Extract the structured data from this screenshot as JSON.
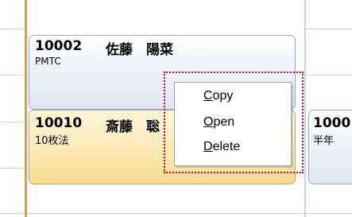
{
  "cards": [
    {
      "id": "10002",
      "name": "佐藤　陽菜",
      "sub": "PMTC",
      "color": "blue"
    },
    {
      "id": "10010",
      "name": "斎藤　聡",
      "sub": "10枚法",
      "color": "yellow"
    },
    {
      "id": "1000",
      "name": "",
      "sub": "半年",
      "color": "blue"
    }
  ],
  "context_menu": {
    "items": [
      {
        "label": "Copy",
        "accel": "C"
      },
      {
        "label": "Open",
        "accel": "O"
      },
      {
        "label": "Delete",
        "accel": "D"
      }
    ]
  },
  "colors": {
    "highlight_border": "#e0001a",
    "accent_line": "#e29a55",
    "card_blue": "#dfe6f3",
    "card_yellow": "#fde9b4"
  }
}
